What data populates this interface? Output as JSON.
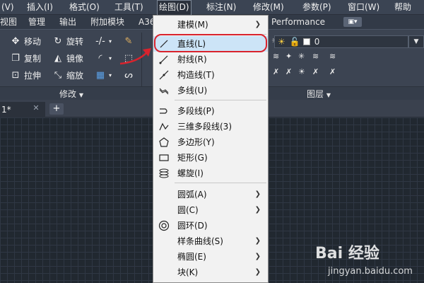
{
  "menubar": {
    "items": [
      "(V)",
      "插入(I)",
      "格式(O)",
      "工具(T)",
      "绘图(D)",
      "标注(N)",
      "修改(M)",
      "参数(P)",
      "窗口(W)",
      "帮助"
    ]
  },
  "ribbon_tabs": {
    "items": [
      "视图",
      "管理",
      "输出",
      "附加模块",
      "A36",
      "Performance"
    ]
  },
  "ribbon": {
    "modify_buttons": [
      "移动",
      "旋转",
      "复制",
      "镜像",
      "拉伸",
      "缩放"
    ],
    "modify_panel_title": "修改",
    "layers_panel_title": "图层",
    "layer_value": "0"
  },
  "doc_tabs": {
    "active_suffix": "1*",
    "close_glyph": "✕",
    "new_glyph": "+"
  },
  "dropdown": {
    "items": [
      {
        "label": "建模(M)",
        "submenu": true
      },
      {
        "label": "直线(L)",
        "submenu": false
      },
      {
        "label": "射线(R)",
        "submenu": false
      },
      {
        "label": "构造线(T)",
        "submenu": false
      },
      {
        "label": "多线(U)",
        "submenu": false
      },
      {
        "label": "多段线(P)",
        "submenu": false
      },
      {
        "label": "三维多段线(3)",
        "submenu": false
      },
      {
        "label": "多边形(Y)",
        "submenu": false
      },
      {
        "label": "矩形(G)",
        "submenu": false
      },
      {
        "label": "螺旋(I)",
        "submenu": false
      },
      {
        "label": "圆弧(A)",
        "submenu": true
      },
      {
        "label": "圆(C)",
        "submenu": true
      },
      {
        "label": "圆环(D)",
        "submenu": false
      },
      {
        "label": "样条曲线(S)",
        "submenu": true
      },
      {
        "label": "椭圆(E)",
        "submenu": true
      },
      {
        "label": "块(K)",
        "submenu": true
      }
    ]
  },
  "watermark": {
    "logo": "Bai 经验",
    "url": "jingyan.baidu.com"
  },
  "colors": {
    "accent_highlight": "#cce4f7",
    "annotation_red": "#d9232d"
  }
}
